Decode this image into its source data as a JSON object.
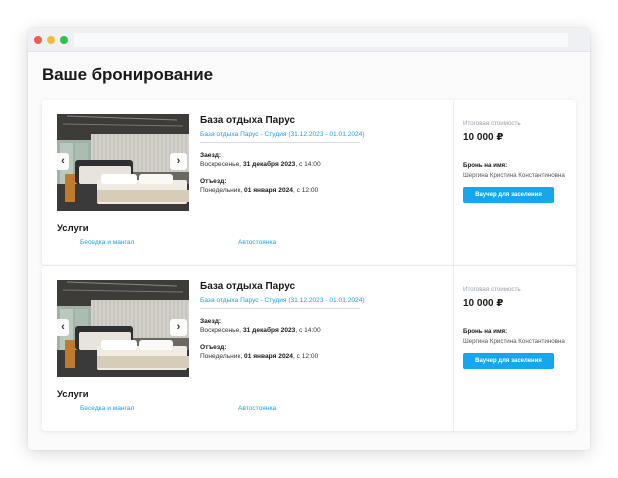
{
  "page": {
    "title": "Ваше бронирование"
  },
  "bookings": [
    {
      "hotel_name": "База отдыха Парус",
      "room": "База отдыха Парус - Студия (31.12.2023 - 01.01.2024)",
      "checkin_label": "Заезд:",
      "checkin_day": "Воскресенье,",
      "checkin_date": "31 декабря 2023",
      "checkin_time": ", с 14:00",
      "checkout_label": "Отъезд:",
      "checkout_day": "Понедельник,",
      "checkout_date": "01 января 2024",
      "checkout_time": ", с 12:00",
      "services_title": "Услуги",
      "services": [
        "Беседка и мангал",
        "Автостоянка"
      ],
      "total_label": "Итоговая стоимость",
      "total_value": "10 000 ₽",
      "booked_label": "Бронь на имя:",
      "booked_name": "Шергина Кристина Константиновна",
      "voucher_label": "Ваучер для заселения",
      "prev_icon": "‹",
      "next_icon": "›"
    },
    {
      "hotel_name": "База отдыха Парус",
      "room": "База отдыха Парус - Студия (31.12.2023 - 01.01.2024)",
      "checkin_label": "Заезд:",
      "checkin_day": "Воскресенье,",
      "checkin_date": "31 декабря 2023",
      "checkin_time": ", с 14:00",
      "checkout_label": "Отъезд:",
      "checkout_day": "Понедельник,",
      "checkout_date": "01 января 2024",
      "checkout_time": ", с 12:00",
      "services_title": "Услуги",
      "services": [
        "Беседка и мангал",
        "Автостоянка"
      ],
      "total_label": "Итоговая стоимость",
      "total_value": "10 000 ₽",
      "booked_label": "Бронь на имя:",
      "booked_name": "Шергина Кристина Константиновна",
      "voucher_label": "Ваучер для заселения",
      "prev_icon": "‹",
      "next_icon": "›"
    }
  ],
  "colors": {
    "accent": "#14a7ee",
    "link": "#1ba0e6",
    "muted": "#9aa0a8"
  },
  "icons": {
    "window_close": "close-dot-icon",
    "window_minimize": "minimize-dot-icon",
    "window_maximize": "maximize-dot-icon"
  }
}
